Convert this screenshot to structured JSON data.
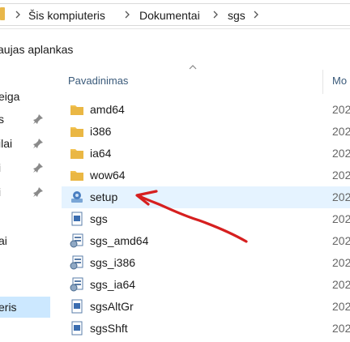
{
  "breadcrumb": {
    "items": [
      "Šis kompiuteris",
      "Dokumentai",
      "sgs"
    ]
  },
  "toolbar": {
    "new_folder_label": "aujas aplankas"
  },
  "nav": {
    "items": [
      {
        "label": "eiga",
        "pinned": false
      },
      {
        "label": "s",
        "pinned": true
      },
      {
        "label": "ilai",
        "pinned": true
      },
      {
        "label": "i",
        "pinned": true
      },
      {
        "label": "i",
        "pinned": true
      },
      {
        "label": "ai",
        "pinned": false
      },
      {
        "label": "eris",
        "pinned": false,
        "selected": true
      }
    ]
  },
  "file_list": {
    "columns": {
      "name": "Pavadinimas",
      "modified": "Mo"
    },
    "files": [
      {
        "name": "amd64",
        "type": "folder",
        "date": "202"
      },
      {
        "name": "i386",
        "type": "folder",
        "date": "202"
      },
      {
        "name": "ia64",
        "type": "folder",
        "date": "202"
      },
      {
        "name": "wow64",
        "type": "folder",
        "date": "202"
      },
      {
        "name": "setup",
        "type": "installer",
        "date": "202",
        "highlighted": true
      },
      {
        "name": "sgs",
        "type": "text-doc",
        "date": "202"
      },
      {
        "name": "sgs_amd64",
        "type": "setup-info",
        "date": "202"
      },
      {
        "name": "sgs_i386",
        "type": "setup-info",
        "date": "202"
      },
      {
        "name": "sgs_ia64",
        "type": "setup-info",
        "date": "202"
      },
      {
        "name": "sgsAltGr",
        "type": "text-doc",
        "date": "202"
      },
      {
        "name": "sgsShft",
        "type": "text-doc",
        "date": "202"
      }
    ]
  },
  "colors": {
    "folder": "#f2c14e",
    "folder_dark": "#dca733",
    "highlight_row": "#e5f3ff",
    "selected_nav": "#cce8ff",
    "annotation_red": "#d61f1f",
    "header_text": "#3a5a7a"
  },
  "icons": {
    "folder": "folder-icon",
    "installer": "installer-icon",
    "text-doc": "document-icon",
    "setup-info": "setup-info-icon",
    "pin": "pin-icon",
    "chevron": "chevron-right-icon",
    "sort": "sort-up-icon"
  },
  "annotation": {
    "type": "hand-drawn-arrow",
    "target": "setup",
    "color": "#d61f1f"
  }
}
